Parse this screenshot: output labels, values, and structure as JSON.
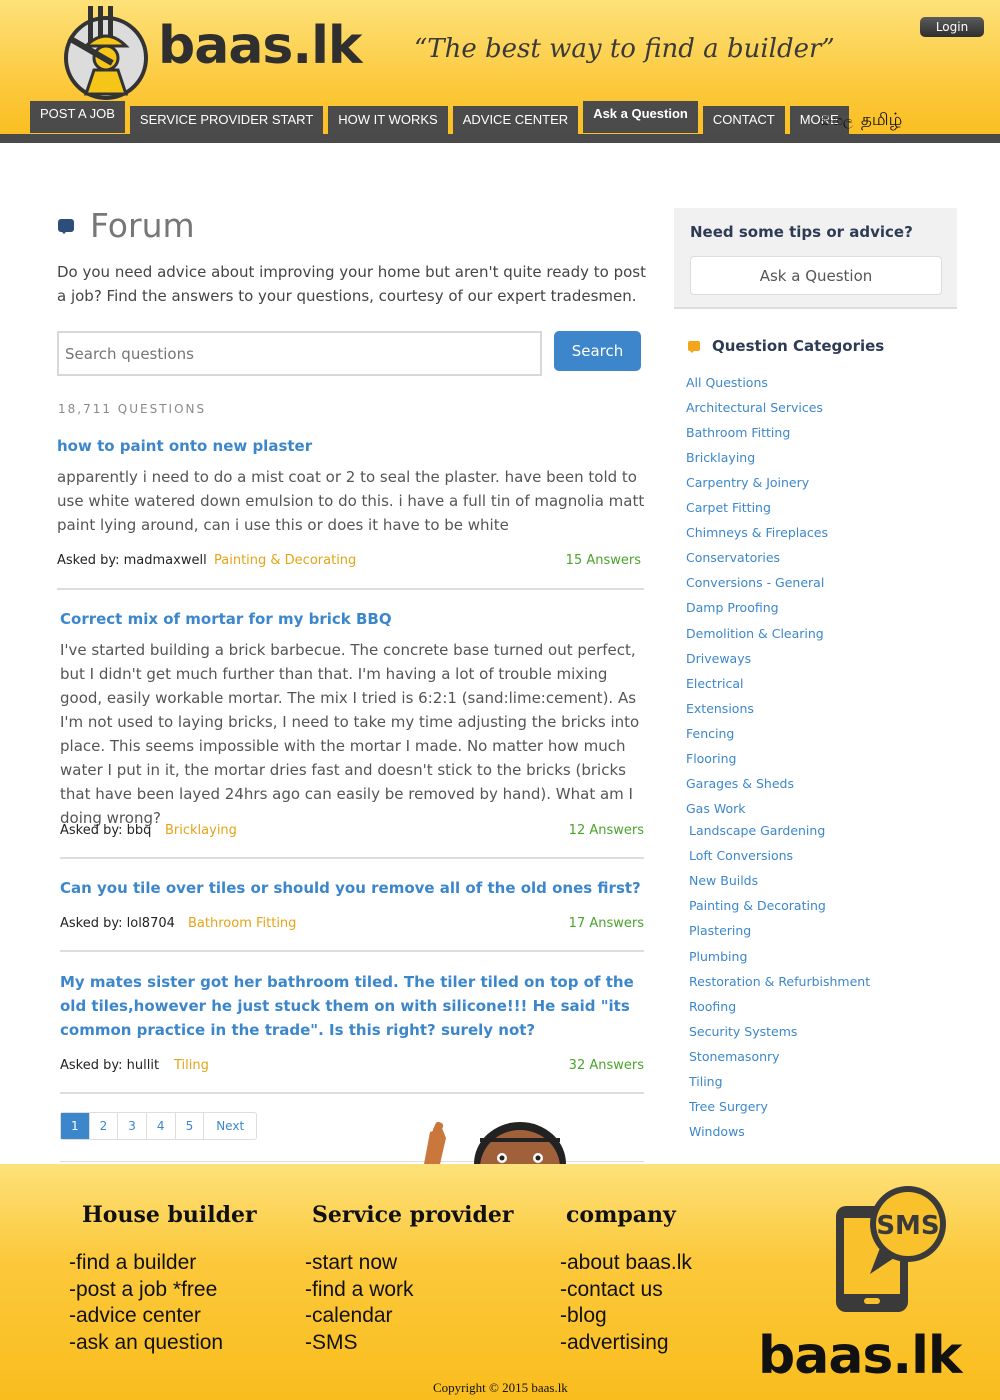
{
  "header": {
    "logo_text": "baas.lk",
    "tagline": "“The best way to find a builder”",
    "login": "Login",
    "nav": [
      "POST A JOB",
      "SERVICE PROVIDER START",
      "HOW IT WORKS",
      "ADVICE CENTER",
      "Ask a Question",
      "CONTACT",
      "MORE"
    ],
    "lang_sinhala": "සිංහල",
    "lang_tamil": "தமிழ்"
  },
  "main": {
    "title": "Forum",
    "intro": "Do you need advice about improving your home but aren't quite ready to post a job? Find the answers to your questions, courtesy of our expert tradesmen.",
    "search_placeholder": "Search questions",
    "search_button": "Search",
    "question_count": "18,711 QUESTIONS",
    "questions": [
      {
        "title": "how to paint onto new plaster",
        "body": "apparently i need to do a mist coat or 2 to seal the plaster. have been told to use white watered down emulsion to do this. i have a full tin of magnolia matt paint lying around, can i use this or does it have to be white",
        "asked_by": "Asked by: madmaxwell",
        "category": "Painting & Decorating",
        "answers": "15 Answers"
      },
      {
        "title": "Correct mix of mortar for my brick BBQ",
        "body": "I've started building a brick barbecue. The concrete base turned out perfect, but I didn't get much further than that. I'm having a lot of trouble mixing good, easily workable mortar. The mix I tried is 6:2:1 (sand:lime:cement). As I'm not used to laying bricks, I need to take my time adjusting the bricks into place. This seems impossible with the mortar I made. No matter how much water I put in it, the mortar dries fast and doesn't stick to the bricks (bricks that have been layed 24hrs ago can easily be removed by hand). What am I doing wrong?",
        "asked_by": "Asked by: bbq",
        "category": "Bricklaying",
        "answers": "12 Answers"
      },
      {
        "title": "Can you tile over tiles or should you remove all of the old ones first?",
        "body": "",
        "asked_by": "Asked by: lol8704",
        "category": "Bathroom Fitting",
        "answers": "17 Answers"
      },
      {
        "title": "My mates sister got her bathroom tiled. The tiler tiled on top of the old tiles,however he just stuck them on with silicone!!! He said \"its common practice in the trade\". Is this right? surely not?",
        "body": "",
        "asked_by": "Asked by: hullit",
        "category": "Tiling",
        "answers": "32 Answers"
      }
    ],
    "pagination": [
      "1",
      "2",
      "3",
      "4",
      "5",
      "Next"
    ]
  },
  "sidebar": {
    "tips_title": "Need some tips or advice?",
    "ask_button": "Ask a Question",
    "categories_title": "Question Categories",
    "categories": [
      "All Questions",
      "Architectural Services",
      "Bathroom Fitting",
      "Bricklaying",
      "Carpentry & Joinery",
      "Carpet Fitting",
      "Chimneys & Fireplaces",
      "Conservatories",
      "Conversions - General",
      "Damp Proofing",
      "Demolition & Clearing",
      "Driveways",
      "Electrical",
      "Extensions",
      "Fencing",
      "Flooring",
      "Garages & Sheds",
      "Gas Work",
      "Landscape Gardening",
      "Loft Conversions",
      "New Builds",
      "Painting & Decorating",
      "Plastering",
      "Plumbing",
      "Restoration & Refurbishment",
      "Roofing",
      "Security Systems",
      "Stonemasonry",
      "Tiling",
      "Tree Surgery",
      "Windows"
    ]
  },
  "footer": {
    "col1_title": "House builder",
    "col1_items": [
      "-find a builder",
      "-post a job *free",
      "-advice center",
      "-ask an question"
    ],
    "col2_title": "Service provider",
    "col2_items": [
      "-start now",
      "-find a work",
      "-calendar",
      "-SMS"
    ],
    "col3_title": "company",
    "col3_items": [
      "-about baas.lk",
      "-contact us",
      "-blog",
      "-advertising"
    ],
    "sms_label": "SMS",
    "logo_text": "baas.lk",
    "copyright": "Copyright © 2015 baas.lk"
  },
  "colors": {
    "brand_yellow": "#fcc93c",
    "nav_gray": "#4b4b4b",
    "link_blue": "#3c87cc",
    "category_orange": "#e5a317",
    "answers_green": "#4aa42a"
  }
}
